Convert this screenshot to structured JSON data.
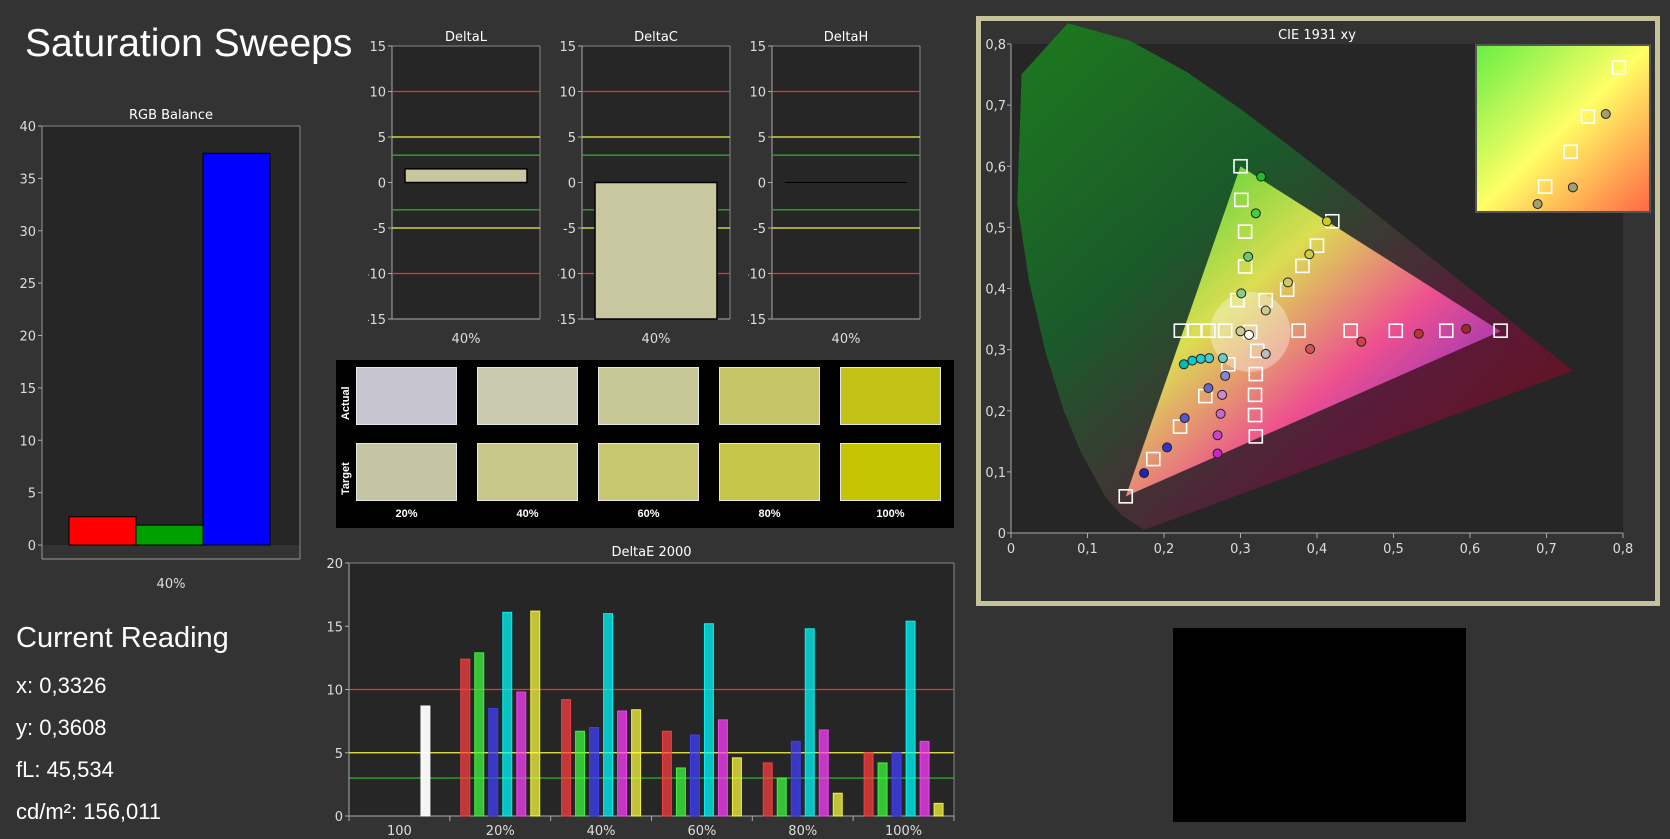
{
  "page": {
    "title": "Saturation Sweeps"
  },
  "reading": {
    "title": "Current Reading",
    "x": "x: 0,3326",
    "y": "y: 0,3608",
    "fl": "fL: 45,534",
    "cdm2": "cd/m²: 156,011"
  },
  "swatches": {
    "row_labels": [
      "Actual",
      "Target"
    ],
    "labels": [
      "20%",
      "40%",
      "60%",
      "80%",
      "100%"
    ],
    "actual_colors": [
      "#c7c6d0",
      "#c9c9b0",
      "#c8c897",
      "#c5c466",
      "#c3c216"
    ],
    "target_colors": [
      "#c5c5a3",
      "#c7c789",
      "#c8c870",
      "#c6c64a",
      "#c4c400"
    ]
  },
  "colors": {
    "background": "#333333",
    "plot_bg": "#262626",
    "red_line": "#ff2a2a",
    "yellow_line": "#f2f24b",
    "green_line": "#2fa52f",
    "frame": "#c6c29a"
  },
  "chart_data": [
    {
      "id": "rgb_balance",
      "type": "bar",
      "title": "RGB Balance",
      "categories": [
        "40%"
      ],
      "series": [
        {
          "color": "#ff0000",
          "values": [
            2.7
          ]
        },
        {
          "color": "#00a000",
          "values": [
            1.9
          ]
        },
        {
          "color": "#0000ff",
          "values": [
            37.4
          ]
        }
      ],
      "ylim": [
        0,
        40
      ],
      "yticks": [
        0,
        5,
        10,
        15,
        20,
        25,
        30,
        35,
        40
      ]
    },
    {
      "id": "delta_l",
      "type": "bar",
      "title": "DeltaL",
      "categories": [
        "40%"
      ],
      "values": [
        1.5
      ],
      "ylim": [
        -15,
        15
      ],
      "yticks": [
        -15,
        -10,
        -5,
        0,
        5,
        10,
        15
      ],
      "reference_lines": [
        10,
        -10,
        5,
        -5,
        3,
        -3
      ]
    },
    {
      "id": "delta_c",
      "type": "bar",
      "title": "DeltaC",
      "categories": [
        "40%"
      ],
      "values": [
        -15
      ],
      "ylim": [
        -15,
        15
      ],
      "yticks": [
        -15,
        -10,
        -5,
        0,
        5,
        10,
        15
      ],
      "reference_lines": [
        10,
        -10,
        5,
        -5,
        3,
        -3
      ]
    },
    {
      "id": "delta_h",
      "type": "bar",
      "title": "DeltaH",
      "categories": [
        "40%"
      ],
      "values": [
        0
      ],
      "ylim": [
        -15,
        15
      ],
      "yticks": [
        -15,
        -10,
        -5,
        0,
        5,
        10,
        15
      ],
      "reference_lines": [
        10,
        -10,
        5,
        -5,
        3,
        -3
      ]
    },
    {
      "id": "deltae_2000",
      "type": "bar",
      "title": "DeltaE 2000",
      "categories": [
        "100",
        "20%",
        "40%",
        "60%",
        "80%",
        "100%"
      ],
      "ylim": [
        0,
        20
      ],
      "yticks": [
        0,
        5,
        10,
        15,
        20
      ],
      "reference_lines": [
        10,
        5,
        3
      ],
      "series": [
        {
          "color": "#ffffff",
          "values": [
            8.7,
            null,
            null,
            null,
            null,
            null
          ]
        },
        {
          "color": "#ff4040",
          "values": [
            null,
            12.4,
            9.2,
            6.7,
            4.2,
            5.0
          ]
        },
        {
          "color": "#40ff40",
          "values": [
            null,
            12.9,
            6.7,
            3.8,
            3.0,
            4.2
          ]
        },
        {
          "color": "#4040ff",
          "values": [
            null,
            8.5,
            7.0,
            6.4,
            5.9,
            5.0
          ]
        },
        {
          "color": "#00ffff",
          "values": [
            null,
            16.1,
            16.0,
            15.2,
            14.8,
            15.4
          ]
        },
        {
          "color": "#ff40ff",
          "values": [
            null,
            9.8,
            8.3,
            7.6,
            6.8,
            5.9
          ]
        },
        {
          "color": "#ffff40",
          "values": [
            null,
            16.2,
            8.4,
            4.6,
            1.8,
            1.0
          ]
        }
      ]
    },
    {
      "id": "cie_1931_xy",
      "type": "scatter",
      "title": "CIE 1931 xy",
      "xlim": [
        0,
        0.8
      ],
      "ylim": [
        0,
        0.8
      ],
      "xticks": [
        "0",
        "0,1",
        "0,2",
        "0,3",
        "0,4",
        "0,5",
        "0,6",
        "0,7",
        "0,8"
      ],
      "yticks": [
        "0",
        "0,1",
        "0,2",
        "0,3",
        "0,4",
        "0,5",
        "0,6",
        "0,7",
        "0,8"
      ],
      "gamut": [
        [
          0.64,
          0.33
        ],
        [
          0.3,
          0.6
        ],
        [
          0.15,
          0.06
        ]
      ],
      "white_point": [
        0.3127,
        0.329
      ],
      "targets": [
        [
          0.3127,
          0.329
        ],
        [
          0.376,
          0.331
        ],
        [
          0.444,
          0.331
        ],
        [
          0.503,
          0.331
        ],
        [
          0.569,
          0.331
        ],
        [
          0.64,
          0.331
        ],
        [
          0.296,
          0.381
        ],
        [
          0.306,
          0.436
        ],
        [
          0.306,
          0.493
        ],
        [
          0.301,
          0.545
        ],
        [
          0.3,
          0.6
        ],
        [
          0.28,
          0.331
        ],
        [
          0.258,
          0.331
        ],
        [
          0.24,
          0.331
        ],
        [
          0.222,
          0.331
        ],
        [
          0.284,
          0.276
        ],
        [
          0.254,
          0.224
        ],
        [
          0.221,
          0.174
        ],
        [
          0.186,
          0.121
        ],
        [
          0.15,
          0.06
        ],
        [
          0.322,
          0.298
        ],
        [
          0.32,
          0.26
        ],
        [
          0.319,
          0.226
        ],
        [
          0.319,
          0.193
        ],
        [
          0.32,
          0.158
        ],
        [
          0.333,
          0.381
        ],
        [
          0.361,
          0.398
        ],
        [
          0.381,
          0.437
        ],
        [
          0.4,
          0.47
        ],
        [
          0.42,
          0.51
        ]
      ],
      "measured": [
        {
          "color": "#ffffff",
          "x": 0.3111,
          "y": 0.3242
        },
        {
          "color": "#cc5555",
          "x": 0.391,
          "y": 0.301
        },
        {
          "color": "#cc4444",
          "x": 0.458,
          "y": 0.313
        },
        {
          "color": "#bb3333",
          "x": 0.533,
          "y": 0.326
        },
        {
          "color": "#aa2222",
          "x": 0.595,
          "y": 0.334
        },
        {
          "color": "#88cc88",
          "x": 0.301,
          "y": 0.392
        },
        {
          "color": "#66cc66",
          "x": 0.31,
          "y": 0.452
        },
        {
          "color": "#44cc44",
          "x": 0.32,
          "y": 0.523
        },
        {
          "color": "#22bb22",
          "x": 0.327,
          "y": 0.583
        },
        {
          "color": "#66cccc",
          "x": 0.277,
          "y": 0.286
        },
        {
          "color": "#44cccc",
          "x": 0.259,
          "y": 0.286
        },
        {
          "color": "#22cccc",
          "x": 0.248,
          "y": 0.285
        },
        {
          "color": "#00cccc",
          "x": 0.237,
          "y": 0.282
        },
        {
          "color": "#00bbbb",
          "x": 0.226,
          "y": 0.276
        },
        {
          "color": "#8888cc",
          "x": 0.28,
          "y": 0.257
        },
        {
          "color": "#6666cc",
          "x": 0.258,
          "y": 0.237
        },
        {
          "color": "#5555cc",
          "x": 0.227,
          "y": 0.188
        },
        {
          "color": "#3333cc",
          "x": 0.204,
          "y": 0.14
        },
        {
          "color": "#2222bb",
          "x": 0.174,
          "y": 0.098
        },
        {
          "color": "#cc88cc",
          "x": 0.276,
          "y": 0.226
        },
        {
          "color": "#cc66cc",
          "x": 0.274,
          "y": 0.195
        },
        {
          "color": "#cc44cc",
          "x": 0.27,
          "y": 0.16
        },
        {
          "color": "#cc22cc",
          "x": 0.27,
          "y": 0.13
        },
        {
          "color": "#cccc88",
          "x": 0.333,
          "y": 0.364
        },
        {
          "color": "#cccc66",
          "x": 0.362,
          "y": 0.41
        },
        {
          "color": "#cccc44",
          "x": 0.39,
          "y": 0.456
        },
        {
          "color": "#cccc22",
          "x": 0.413,
          "y": 0.51
        },
        {
          "color": "#cccc99",
          "x": 0.3,
          "y": 0.33
        },
        {
          "color": "#bbbbbb",
          "x": 0.333,
          "y": 0.293
        }
      ],
      "inset": {
        "xlim": [
          0.298,
          0.335
        ],
        "ylim": [
          0.322,
          0.368
        ],
        "targets": [
          [
            0.3127,
            0.329
          ],
          [
            0.3181,
            0.3386
          ],
          [
            0.3218,
            0.3483
          ],
          [
            0.3284,
            0.3618
          ]
        ],
        "measured": [
          [
            0.3111,
            0.3242
          ],
          [
            0.3256,
            0.349
          ],
          [
            0.3186,
            0.3288
          ]
        ]
      }
    }
  ]
}
